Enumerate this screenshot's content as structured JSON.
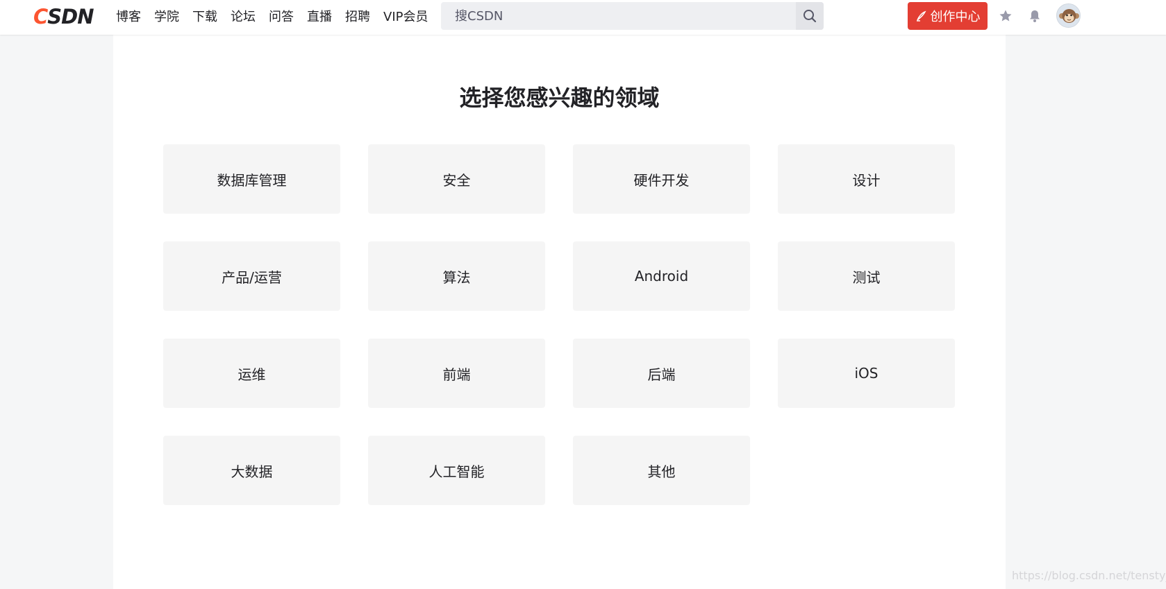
{
  "header": {
    "logo": {
      "c": "C",
      "rest": "SDN"
    },
    "nav": [
      "博客",
      "学院",
      "下载",
      "论坛",
      "问答",
      "直播",
      "招聘",
      "VIP会员"
    ],
    "search": {
      "placeholder": "搜CSDN",
      "value": ""
    },
    "create_label": "创作中心",
    "icons": [
      "search-icon",
      "pen-icon",
      "star-icon",
      "bell-icon",
      "avatar"
    ]
  },
  "main": {
    "title": "选择您感兴趣的领域",
    "domains": [
      "数据库管理",
      "安全",
      "硬件开发",
      "设计",
      "产品/运营",
      "算法",
      "Android",
      "测试",
      "运维",
      "前端",
      "后端",
      "iOS",
      "大数据",
      "人工智能",
      "其他"
    ]
  },
  "watermark": "https://blog.csdn.net/tensty_zh",
  "colors": {
    "brand_red": "#e33e33",
    "logo_red": "#fc5531",
    "card_bg": "#f5f5f5",
    "page_bg": "#f5f6f7"
  }
}
